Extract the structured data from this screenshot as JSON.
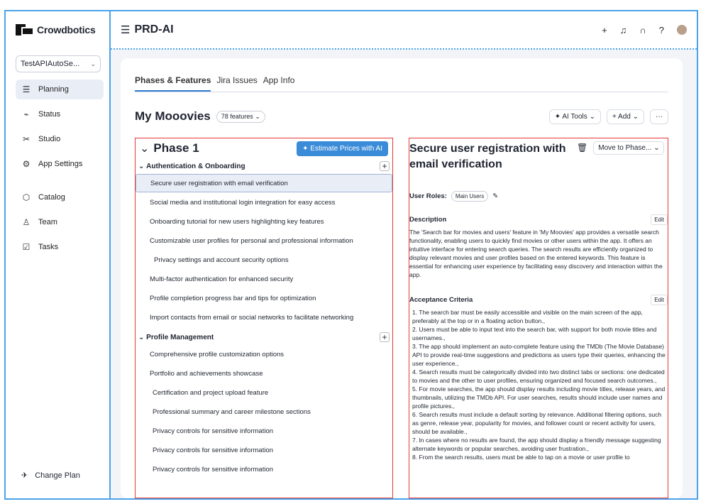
{
  "brand": {
    "name": "Crowdbotics"
  },
  "project_selector": {
    "value": "TestAPIAutoSe..."
  },
  "sidebar": {
    "items": [
      {
        "label": "Planning",
        "icon": "planning-icon"
      },
      {
        "label": "Status",
        "icon": "status-icon"
      },
      {
        "label": "Studio",
        "icon": "studio-icon"
      },
      {
        "label": "App Settings",
        "icon": "settings-icon"
      },
      {
        "label": "Catalog",
        "icon": "catalog-icon"
      },
      {
        "label": "Team",
        "icon": "team-icon"
      },
      {
        "label": "Tasks",
        "icon": "tasks-icon"
      }
    ],
    "change_plan": "Change Plan"
  },
  "header": {
    "title": "PRD-AI"
  },
  "tabs": [
    {
      "label": "Phases & Features"
    },
    {
      "label": "Jira Issues"
    },
    {
      "label": "App Info"
    }
  ],
  "project": {
    "name": "My Mooovies",
    "feature_count": "78 features",
    "ai_tools": "AI Tools",
    "add": "Add",
    "more": "···"
  },
  "phase": {
    "title": "Phase 1",
    "estimate_btn": "Estimate Prices with AI",
    "sections": [
      {
        "name": "Authentication & Onboarding",
        "features": [
          "Secure user registration with email verification",
          "Social media and institutional login integration for easy access",
          "Onboarding tutorial for new users highlighting key features",
          "Customizable user profiles for personal and professional information",
          "Privacy settings and account security options",
          "Multi-factor authentication for enhanced security",
          "Profile completion progress bar and tips for optimization",
          "Import contacts from email or social networks to facilitate networking"
        ]
      },
      {
        "name": "Profile Management",
        "features": [
          "Comprehensive profile customization options",
          "Portfolio and achievements showcase",
          "Certification and project upload feature",
          "Professional summary and career milestone sections",
          "Privacy controls for sensitive information",
          "Privacy controls for sensitive information",
          "Privacy controls for sensitive information"
        ]
      }
    ]
  },
  "detail": {
    "title": "Secure user registration with email verification",
    "move_btn": "Move to Phase...",
    "roles_label": "User Roles:",
    "role": "Main Users",
    "description_label": "Description",
    "edit": "Edit",
    "description": "The 'Search bar for movies and users' feature in 'My Moovies' app provides a versatile search functionality, enabling users to quickly find movies or other users within the app. It offers an intuitive interface for entering search queries. The search results are efficiently organized to display relevant movies and user profiles based on the entered keywords. This feature is essential for enhancing user experience by facilitating easy discovery and interaction within the app.",
    "criteria_label": "Acceptance Criteria",
    "criteria": [
      "1. The search bar must be easily accessible and visible on the main screen of the app, preferably at the top or in a floating action button.,",
      "2.   Users must be able to input text into the search bar, with support for both movie titles and usernames.,",
      "3.   The app should implement an auto-complete feature using the TMDb (The Movie Database) API to provide real-time suggestions and predictions as users type their queries, enhancing the user experience.,",
      "4.   Search results must be categorically divided into two distinct tabs or sections: one dedicated to movies and the other to user profiles, ensuring organized and focused search outcomes.,",
      "5.   For movie searches, the app should display results including movie titles, release years, and thumbnails, utilizing the TMDb API. For user searches, results should include user names and profile pictures.,",
      "6.   Search results must include a default sorting by relevance. Additional filtering options, such as genre, release year, popularity for movies, and follower count or recent activity for users, should be available.,",
      "7.   In cases where no results are found, the app should display a friendly message suggesting alternate keywords or popular searches, avoiding user frustration.,",
      "8.   From the search results, users must be able to tap on a movie or user profile to"
    ]
  }
}
